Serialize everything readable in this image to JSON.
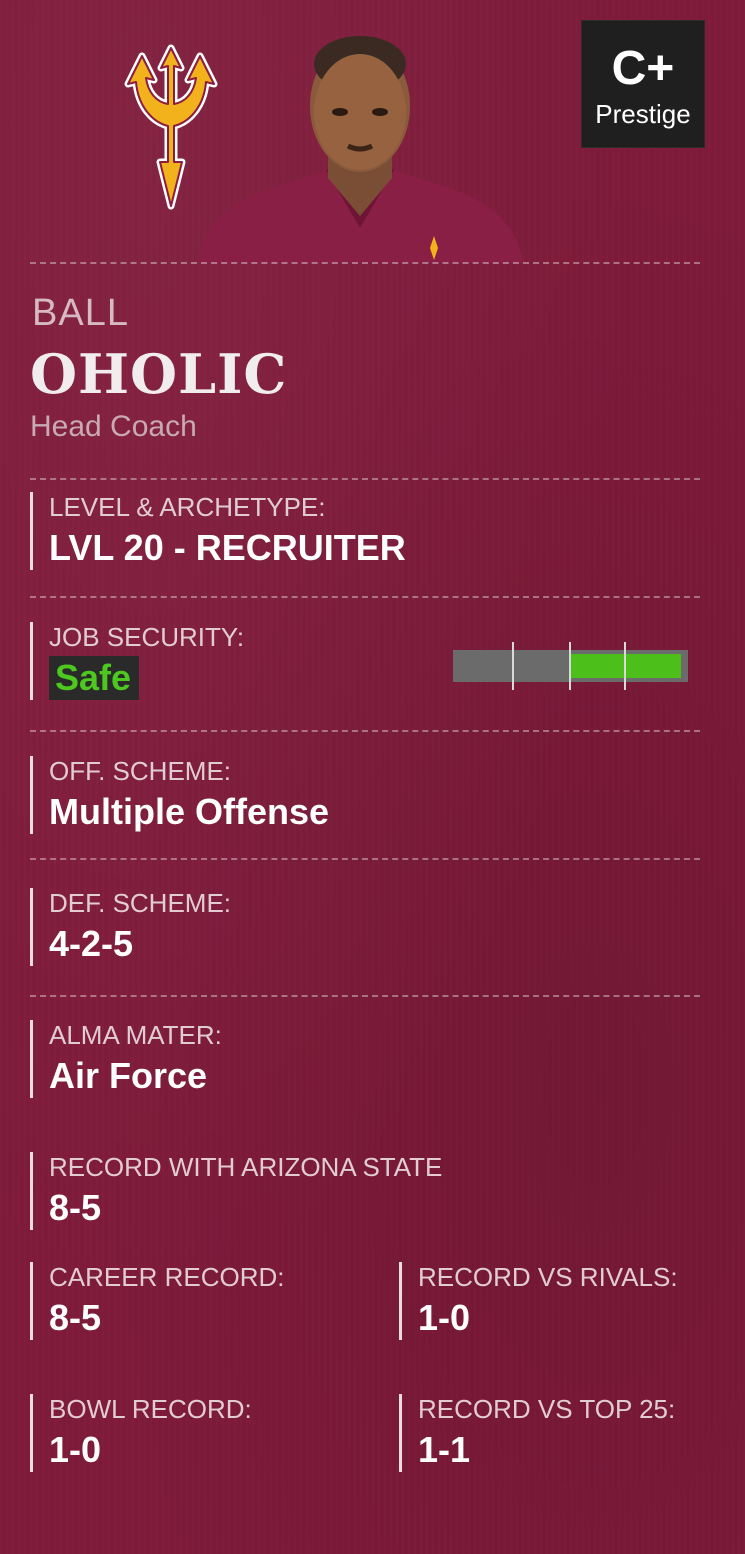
{
  "prestige": {
    "grade": "C+",
    "label": "Prestige"
  },
  "coach": {
    "first_name": "BALL",
    "last_name": "OHOLIC",
    "role": "Head Coach"
  },
  "level": {
    "label": "LEVEL & ARCHETYPE:",
    "value": "LVL 20 - RECRUITER"
  },
  "job_security": {
    "label": "JOB SECURITY:",
    "value": "Safe",
    "level_fraction": 0.52,
    "color": "#4cbf1b"
  },
  "offense": {
    "label": "OFF. SCHEME:",
    "value": "Multiple Offense"
  },
  "defense": {
    "label": "DEF. SCHEME:",
    "value": "4-2-5"
  },
  "alma_mater": {
    "label": "ALMA MATER:",
    "value": "Air Force"
  },
  "record_team": {
    "label": "RECORD WITH ARIZONA STATE",
    "value": "8-5"
  },
  "career": {
    "label": "CAREER RECORD:",
    "value": "8-5"
  },
  "rivals": {
    "label": "RECORD VS RIVALS:",
    "value": "1-0"
  },
  "bowl": {
    "label": "BOWL RECORD:",
    "value": "1-0"
  },
  "top25": {
    "label": "RECORD VS TOP 25:",
    "value": "1-1"
  },
  "icons": {
    "logo": "pitchfork-logo",
    "portrait": "coach-portrait"
  },
  "colors": {
    "background": "#7e1a3a",
    "accent_gold": "#f4b31d",
    "safe_green": "#4cc81f"
  }
}
